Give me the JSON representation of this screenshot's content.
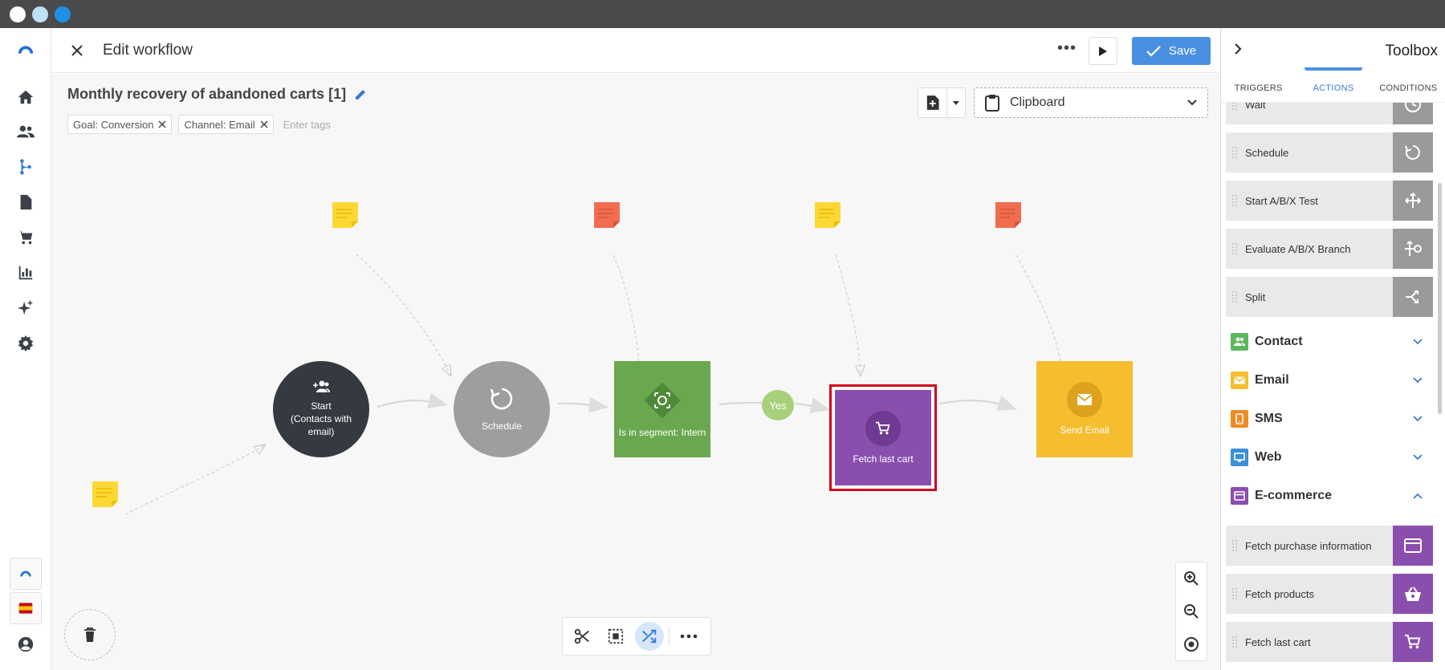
{
  "window": {
    "traffic_colors": [
      "#ffffff",
      "#bfe0f7",
      "#1e90e8"
    ]
  },
  "header": {
    "title": "Edit workflow",
    "more_label": "•••",
    "save_label": "Save"
  },
  "workflow": {
    "name": "Monthly recovery of abandoned carts [1]",
    "tags": [
      "Goal: Conversion",
      "Channel: Email"
    ],
    "tags_placeholder": "Enter tags"
  },
  "clipboard": {
    "label": "Clipboard"
  },
  "nodes": {
    "start": {
      "label_line1": "Start",
      "label_line2": "(Contacts with",
      "label_line3": "email)",
      "color": "#343a40"
    },
    "schedule": {
      "label": "Schedule",
      "color": "#9e9e9e"
    },
    "segment": {
      "label": "Is in segment: Intern",
      "color": "#6aa84f"
    },
    "fetch": {
      "label": "Fetch last cart",
      "color": "#8a4fae",
      "selected_border": "#d0021b"
    },
    "email": {
      "label": "Send Email",
      "color": "#f6bd2f"
    }
  },
  "edge_labels": {
    "yes": "Yes"
  },
  "toolbox": {
    "title": "Toolbox",
    "tabs": [
      "TRIGGERS",
      "ACTIONS",
      "CONDITIONS"
    ],
    "active_tab": "ACTIONS",
    "flow_actions": [
      "Wait",
      "Schedule",
      "Start A/B/X Test",
      "Evaluate A/B/X Branch",
      "Split"
    ],
    "categories": {
      "contact": "Contact",
      "email": "Email",
      "sms": "SMS",
      "web": "Web",
      "ecommerce": "E-commerce"
    },
    "ecommerce_actions": [
      "Fetch purchase information",
      "Fetch products",
      "Fetch last cart"
    ]
  },
  "colors": {
    "accent": "#4a90e2",
    "contact": "#5cb85c",
    "email": "#f6bd2f",
    "sms": "#f08a24",
    "web": "#3a8fd8",
    "ecommerce": "#8a4fae"
  }
}
